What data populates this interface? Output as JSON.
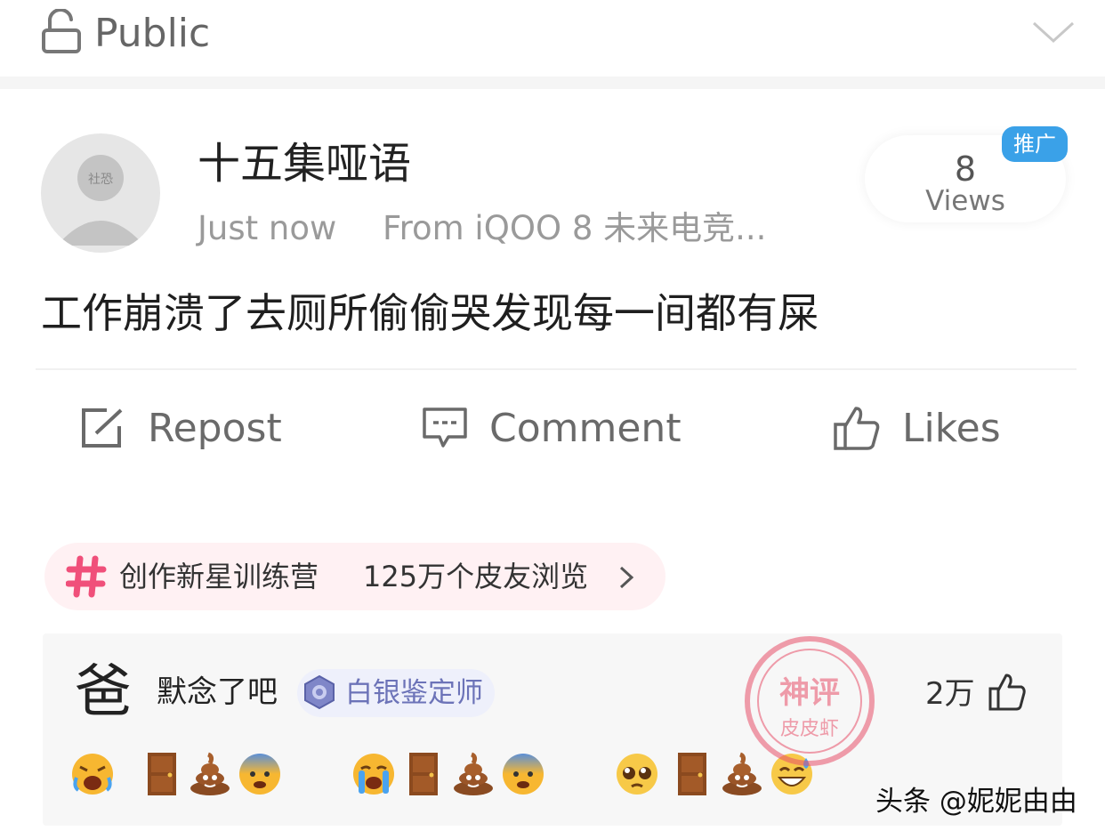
{
  "topbar": {
    "visibility_label": "Public",
    "lock_icon": "lock-open-icon",
    "chevron_icon": "chevron-down-icon"
  },
  "post": {
    "avatar_text": "社恐",
    "author_name": "十五集哑语",
    "time": "Just now",
    "source": "From iQOO 8 未来电竞...",
    "views_count": "8",
    "views_label": "Views",
    "promo_badge": "推广",
    "text": "工作崩溃了去厕所偷偷哭发现每一间都有屎",
    "actions": [
      {
        "label": "Repost",
        "icon": "repost-icon"
      },
      {
        "label": "Comment",
        "icon": "comment-icon"
      },
      {
        "label": "Likes",
        "icon": "thumbs-up-icon"
      }
    ]
  },
  "topic": {
    "name": "创作新星训练营",
    "views": "125万个皮友浏览",
    "chevron": "›"
  },
  "comment": {
    "avatar_text": "爸",
    "text": "默念了吧",
    "badge_label": "白银鉴定师",
    "like_count": "2万",
    "emoji_groups": [
      [
        "tired-face-emoji",
        "door-emoji",
        "poo-emoji",
        "fearful-face-emoji"
      ],
      [
        "crying-face-emoji",
        "door-emoji",
        "poo-emoji",
        "fearful-face-emoji"
      ],
      [
        "pleading-face-emoji",
        "door-emoji",
        "poo-emoji",
        "sweat-smile-emoji"
      ]
    ]
  },
  "stamp": {
    "line1": "神评",
    "line2": "皮皮虾"
  },
  "watermark": "头条 @妮妮由由",
  "colors": {
    "accent_blue": "#3aa1e8",
    "topic_pink": "#f0507a",
    "badge_purple": "#6c73b8",
    "stamp_red": "#e8506a"
  }
}
